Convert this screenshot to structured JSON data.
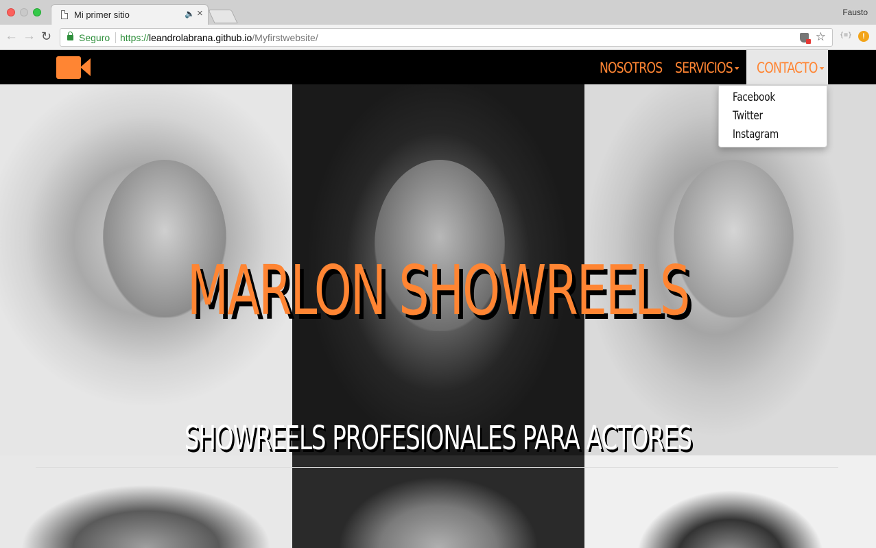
{
  "browser": {
    "tab_title": "Mi primer sitio",
    "profile_name": "Fausto",
    "secure_label": "Seguro",
    "url_scheme": "https://",
    "url_host": "leandrolabrana.github.io",
    "url_path": "/Myfirstwebsite/",
    "icons": [
      "back-icon",
      "forward-icon",
      "reload-icon",
      "lock-icon",
      "shield-icon",
      "star-icon",
      "page-icon",
      "speaker-icon",
      "close-icon"
    ]
  },
  "site": {
    "brand_color": "#ff8533",
    "nav": {
      "nosotros": "NOSOTROS",
      "servicios": "SERVICIOS",
      "contacto": "CONTACTO"
    },
    "dropdown": [
      "Facebook",
      "Twitter",
      "Instagram"
    ],
    "hero": {
      "title": "MARLON SHOWREELS",
      "subtitle": "SHOWREELS PROFESIONALES PARA ACTORES"
    }
  }
}
